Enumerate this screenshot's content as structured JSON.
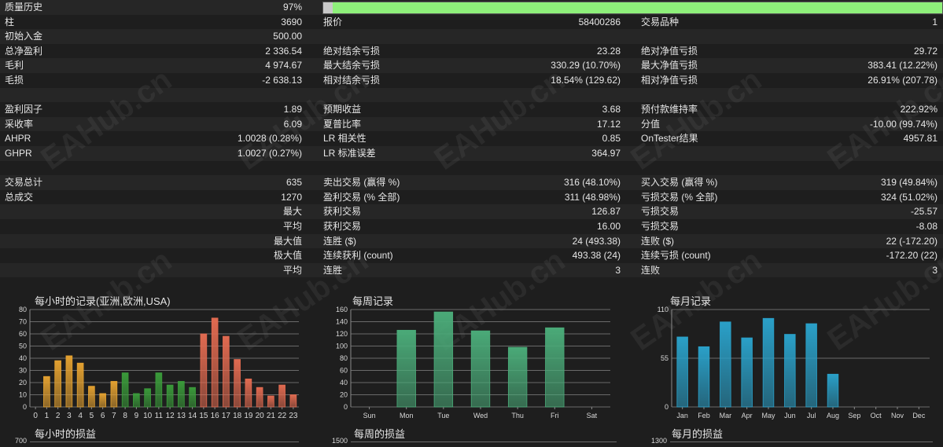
{
  "quality": {
    "label": "质量历史",
    "value": "97%",
    "fraction": 0.97
  },
  "rows": [
    {
      "a": [
        "柱",
        "3690"
      ],
      "b": [
        "报价",
        "58400286"
      ],
      "c": [
        "交易品种",
        "1"
      ]
    },
    {
      "a": [
        "初始入金",
        "500.00"
      ],
      "b": [
        "",
        ""
      ],
      "c": [
        "",
        ""
      ]
    },
    {
      "a": [
        "总净盈利",
        "2 336.54"
      ],
      "b": [
        "绝对结余亏损",
        "23.28"
      ],
      "c": [
        "绝对净值亏损",
        "29.72"
      ]
    },
    {
      "a": [
        "毛利",
        "4 974.67"
      ],
      "b": [
        "最大结余亏损",
        "330.29 (10.70%)"
      ],
      "c": [
        "最大净值亏损",
        "383.41 (12.22%)"
      ]
    },
    {
      "a": [
        "毛损",
        "-2 638.13"
      ],
      "b": [
        "相对结余亏损",
        "18.54% (129.62)"
      ],
      "c": [
        "相对净值亏损",
        "26.91% (207.78)"
      ]
    },
    {
      "a": [
        "",
        ""
      ],
      "b": [
        "",
        ""
      ],
      "c": [
        "",
        ""
      ]
    },
    {
      "a": [
        "盈利因子",
        "1.89"
      ],
      "b": [
        "预期收益",
        "3.68"
      ],
      "c": [
        "预付款维持率",
        "222.92%"
      ]
    },
    {
      "a": [
        "采收率",
        "6.09"
      ],
      "b": [
        "夏普比率",
        "17.12"
      ],
      "c": [
        "分值",
        "-10.00 (99.74%)"
      ]
    },
    {
      "a": [
        "AHPR",
        "1.0028 (0.28%)"
      ],
      "b": [
        "LR 相关性",
        "0.85"
      ],
      "c": [
        "OnTester结果",
        "4957.81"
      ]
    },
    {
      "a": [
        "GHPR",
        "1.0027 (0.27%)"
      ],
      "b": [
        "LR 标准误差",
        "364.97"
      ],
      "c": [
        "",
        ""
      ]
    },
    {
      "a": [
        "",
        ""
      ],
      "b": [
        "",
        ""
      ],
      "c": [
        "",
        ""
      ]
    },
    {
      "a": [
        "交易总计",
        "635"
      ],
      "b": [
        "卖出交易 (赢得 %)",
        "316 (48.10%)"
      ],
      "c": [
        "买入交易 (赢得 %)",
        "319 (49.84%)"
      ]
    },
    {
      "a": [
        "总成交",
        "1270"
      ],
      "b": [
        "盈利交易 (% 全部)",
        "311 (48.98%)"
      ],
      "c": [
        "亏损交易 (% 全部)",
        "324 (51.02%)"
      ]
    },
    {
      "a": [
        "",
        "最大"
      ],
      "b": [
        "获利交易",
        "126.87"
      ],
      "c": [
        "亏损交易",
        "-25.57"
      ]
    },
    {
      "a": [
        "",
        "平均"
      ],
      "b": [
        "获利交易",
        "16.00"
      ],
      "c": [
        "亏损交易",
        "-8.08"
      ]
    },
    {
      "a": [
        "",
        "最大值"
      ],
      "b": [
        "连胜 ($)",
        "24 (493.38)"
      ],
      "c": [
        "连败 ($)",
        "22 (-172.20)"
      ]
    },
    {
      "a": [
        "",
        "极大值"
      ],
      "b": [
        "连续获利 (count)",
        "493.38 (24)"
      ],
      "c": [
        "连续亏损 (count)",
        "-172.20 (22)"
      ]
    },
    {
      "a": [
        "",
        "平均"
      ],
      "b": [
        "连胜",
        "3"
      ],
      "c": [
        "连败",
        "3"
      ]
    },
    {
      "a": [
        "",
        ""
      ],
      "b": [
        "",
        ""
      ],
      "c": [
        "",
        ""
      ]
    }
  ],
  "watermark": "EAHub.cn",
  "colors": {
    "quality_fill": "#8ef07a",
    "hourly_low": "#e2a030",
    "hourly_mid": "#3a9a3a",
    "hourly_high": "#e06a50",
    "weekly": "#4aaa78",
    "monthly": "#2aa0c8"
  },
  "chart_data": [
    {
      "type": "bar",
      "title": "每小时的记录(亚洲,欧洲,USA)",
      "categories": [
        "0",
        "1",
        "2",
        "3",
        "4",
        "5",
        "6",
        "7",
        "8",
        "9",
        "10",
        "11",
        "12",
        "13",
        "14",
        "15",
        "16",
        "17",
        "18",
        "19",
        "20",
        "21",
        "22",
        "23"
      ],
      "values": [
        0,
        25,
        38,
        42,
        36,
        17,
        11,
        21,
        28,
        11,
        15,
        28,
        18,
        21,
        16,
        60,
        73,
        58,
        39,
        23,
        16,
        9,
        18,
        10
      ],
      "ylim": [
        0,
        80
      ],
      "yticks": [
        0,
        10,
        20,
        30,
        40,
        50,
        60,
        70,
        80
      ],
      "grid": true
    },
    {
      "type": "bar",
      "title": "每周记录",
      "categories": [
        "Sun",
        "Mon",
        "Tue",
        "Wed",
        "Thu",
        "Fri",
        "Sat"
      ],
      "values": [
        0,
        126,
        156,
        125,
        98,
        130,
        0
      ],
      "ylim": [
        0,
        160
      ],
      "yticks": [
        0,
        20,
        40,
        60,
        80,
        100,
        120,
        140,
        160
      ],
      "grid": true
    },
    {
      "type": "bar",
      "title": "每月记录",
      "categories": [
        "Jan",
        "Feb",
        "Mar",
        "Apr",
        "May",
        "Jun",
        "Jul",
        "Aug",
        "Sep",
        "Oct",
        "Nov",
        "Dec"
      ],
      "values": [
        79,
        68,
        96,
        78,
        100,
        82,
        94,
        37,
        0,
        0,
        0,
        0
      ],
      "ylim": [
        0,
        110
      ],
      "yticks": [
        0,
        55,
        110
      ],
      "grid": true
    }
  ],
  "bottom_charts": [
    {
      "title": "每小时的损益",
      "ytick": "700"
    },
    {
      "title": "每周的损益",
      "ytick": "1500"
    },
    {
      "title": "每月的损益",
      "ytick": "1300"
    }
  ]
}
